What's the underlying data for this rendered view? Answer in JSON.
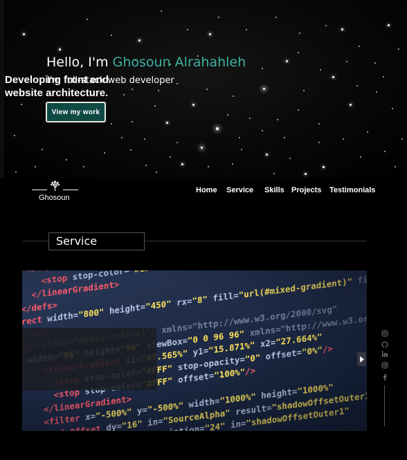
{
  "hero": {
    "greeting": "Hello, I'm ",
    "name": "Ghosoun Alrahahleh",
    "tagline": "I'm full-stack web developer",
    "cta_label": "View my work"
  },
  "nav": {
    "logo_text": "Ghosoun",
    "items": [
      "Home",
      "Service",
      "Skills",
      "Projects",
      "Testimonials"
    ]
  },
  "section": {
    "title": "Service"
  },
  "slide": {
    "caption": "Developing front end website architecture."
  },
  "social": [
    "instagram-icon",
    "github-icon",
    "linkedin-icon",
    "instagram-icon",
    "facebook-icon"
  ],
  "colors": {
    "accent": "#3bb3a1",
    "button_bg": "#0f4a45",
    "background": "#000000"
  }
}
